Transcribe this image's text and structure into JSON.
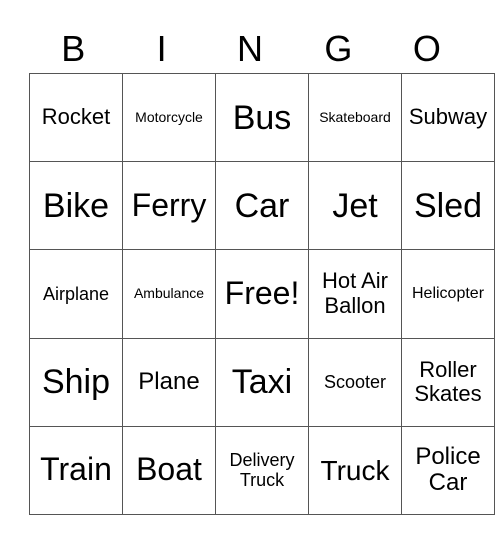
{
  "header": [
    "B",
    "I",
    "N",
    "G",
    "O"
  ],
  "rows": [
    [
      "Rocket",
      "Motorcycle",
      "Bus",
      "Skateboard",
      "Subway"
    ],
    [
      "Bike",
      "Ferry",
      "Car",
      "Jet",
      "Sled"
    ],
    [
      "Airplane",
      "Ambulance",
      "Free!",
      "Hot Air Ballon",
      "Helicopter"
    ],
    [
      "Ship",
      "Plane",
      "Taxi",
      "Scooter",
      "Roller Skates"
    ],
    [
      "Train",
      "Boat",
      "Delivery Truck",
      "Truck",
      "Police Car"
    ]
  ]
}
